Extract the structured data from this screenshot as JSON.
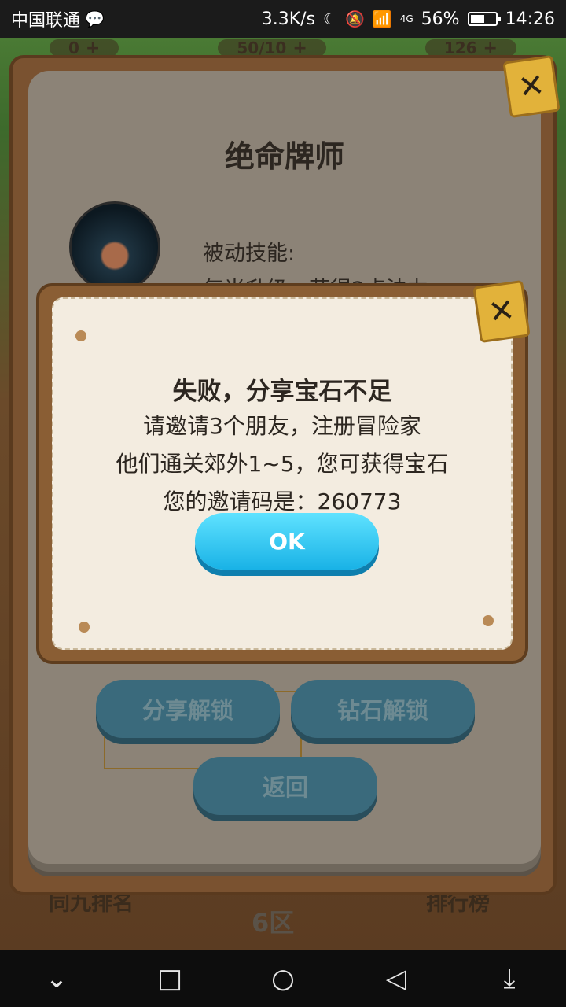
{
  "status_bar": {
    "carrier": "中国联通",
    "net_speed": "3.3K/s",
    "network": "4G",
    "battery_percent": "56%",
    "battery_level": 0.56,
    "time": "14:26"
  },
  "hud": {
    "coins": "0",
    "stamina": "50/10",
    "gems": "126"
  },
  "hero_panel": {
    "title": "绝命牌师",
    "skill_label": "被动技能:",
    "skill_desc": "每当升级，获得2点法力"
  },
  "dialog": {
    "title": "失败，分享宝石不足",
    "line1": "请邀请3个朋友，注册冒险家",
    "line2": "他们通关郊外1~5，您可获得宝石",
    "line3": "您的邀请码是：260773",
    "ok_label": "OK"
  },
  "actions": {
    "share_unlock": "分享解锁",
    "diamond_unlock": "钻石解锁",
    "back": "返回"
  },
  "bottom": {
    "left_label": "同九排名",
    "zone": "6区",
    "right_label": "排行榜"
  },
  "nav": {
    "back_icon": "chevron-down",
    "recents_icon": "square",
    "home_icon": "circle",
    "back_triangle_icon": "triangle-left",
    "notif_icon": "pull-down"
  },
  "colors": {
    "ok_button": "#19b2e6",
    "close_tab": "#e2b23a",
    "dialog_bg": "#f3ece0"
  }
}
